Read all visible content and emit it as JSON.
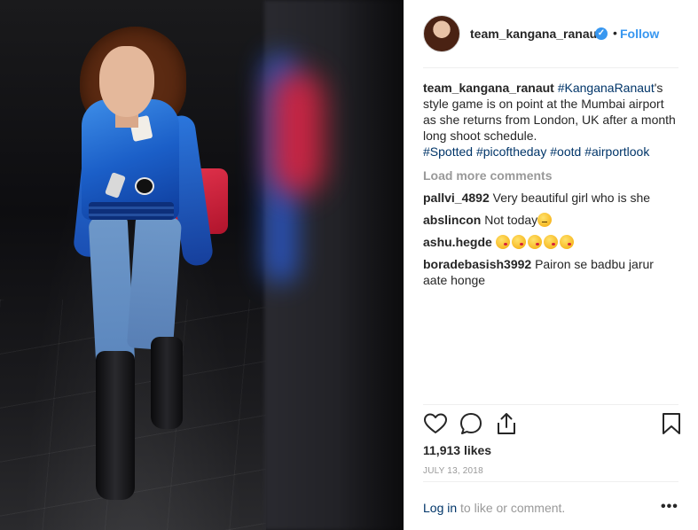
{
  "post": {
    "username": "team_kangana_ranaut",
    "verified_mark": "✓",
    "separator": "•",
    "follow_label": "Follow"
  },
  "caption": {
    "username": "team_kangana_ranaut",
    "tag_kangana": "#KanganaRanaut",
    "text": "'s style game is on point at the Mumbai airport as she returns from London, UK after a month long shoot schedule.",
    "hashtags": [
      "#Spotted",
      "#picoftheday",
      "#ootd",
      "#airportlook"
    ]
  },
  "load_more_label": "Load more comments",
  "comments": [
    {
      "user": "pallvi_4892",
      "text": "Very beautiful girl who is she"
    },
    {
      "user": "abslincon",
      "text": "Not today"
    },
    {
      "user": "ashu.hegde",
      "text": ""
    },
    {
      "user": "boradebasish3992",
      "text": "Pairon se badbu jarur aate honge"
    }
  ],
  "icons": {
    "like": "heart-icon",
    "comment": "comment-icon",
    "share": "share-icon",
    "save": "bookmark-icon",
    "more": "more-options-icon"
  },
  "likes_text": "11,913 likes",
  "date_text": "JULY 13, 2018",
  "login": {
    "link_label": "Log in",
    "rest": " to like or comment."
  },
  "more_label": "•••",
  "colors": {
    "accent": "#3897f0",
    "link": "#003569",
    "muted": "#999999",
    "text": "#262626"
  }
}
